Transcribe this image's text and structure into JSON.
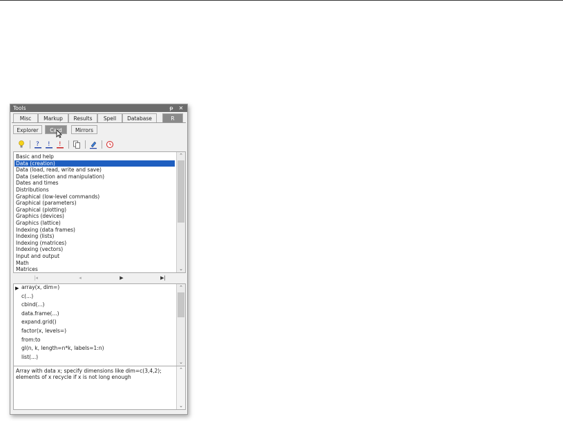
{
  "window": {
    "title": "Tools",
    "pin_label": "ᵽ",
    "close_label": "✕"
  },
  "tabs_top": [
    {
      "label": "Misc"
    },
    {
      "label": "Markup"
    },
    {
      "label": "Results"
    },
    {
      "label": "Spell"
    },
    {
      "label": "Database"
    },
    {
      "label": "R"
    }
  ],
  "tabs_sub": [
    {
      "label": "Explorer"
    },
    {
      "label": "Card"
    },
    {
      "label": "Mirrors"
    }
  ],
  "toolbar_icons": [
    "lightbulb-icon",
    "help-icon",
    "help-blue-icon",
    "help-red-icon",
    "copy-icon",
    "edit-icon",
    "history-icon"
  ],
  "categories": [
    "Basic and help",
    "Data (creation)",
    "Data (load, read, write and save)",
    "Data (selection and manipulation)",
    "Dates and times",
    "Distributions",
    "Graphical (low-level commands)",
    "Graphical (parameters)",
    "Graphical (plotting)",
    "Graphics (devices)",
    "Graphics (lattice)",
    "Indexing (data frames)",
    "Indexing (lists)",
    "Indexing (matrices)",
    "Indexing (vectors)",
    "Input and output",
    "Math",
    "Matrices"
  ],
  "selected_category": "Data (creation)",
  "nav": {
    "first": "|◂",
    "prev": "◂",
    "next": "▶",
    "last": "▶|"
  },
  "functions": [
    "array(x, dim=)",
    "c(...)",
    "cbind(...)",
    "data.frame(...)",
    "expand.grid()",
    "factor(x, levels=)",
    "from:to",
    "gl(n, k, length=n*k, labels=1:n)",
    "list(...)"
  ],
  "description": "Array with data x; specify dimensions like dim=c(3,4,2); elements of x recycle if x is not long enough",
  "colors": {
    "selection": "#1f5fc0",
    "titlebar": "#6b6b6b"
  }
}
